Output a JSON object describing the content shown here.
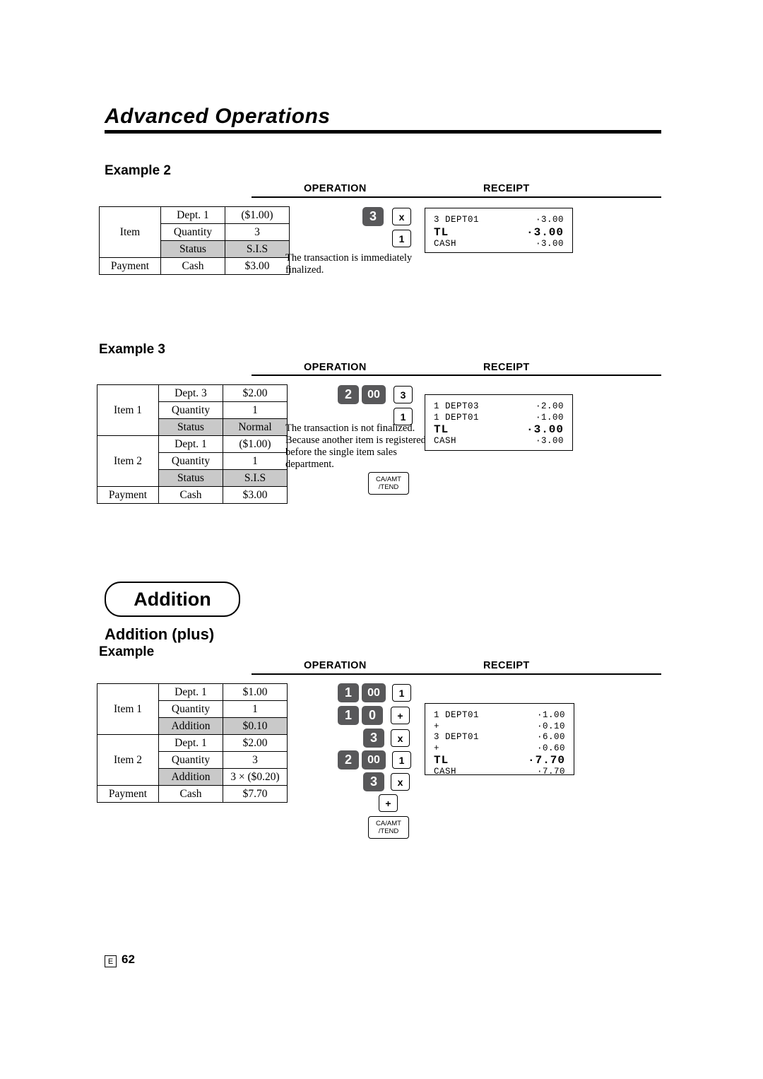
{
  "page": {
    "title": "Advanced Operations",
    "footer_mark": "E",
    "footer_page": "62"
  },
  "columns": {
    "operation": "OPERATION",
    "receipt": "RECEIPT"
  },
  "example2": {
    "heading": "Example 2",
    "table": [
      {
        "c1": "Item",
        "c2": "Dept. 1",
        "c3": "($1.00)",
        "shade": false
      },
      {
        "c1": "",
        "c2": "Quantity",
        "c3": "3",
        "shade": false
      },
      {
        "c1": "",
        "c2": "Status",
        "c3": "S.I.S",
        "shade": true
      },
      {
        "c1": "Payment",
        "c2": "Cash",
        "c3": "$3.00",
        "shade": false
      }
    ],
    "keys": [
      {
        "label": "3",
        "type": "dark"
      },
      {
        "label": "x",
        "type": "light"
      },
      {
        "label": "1",
        "type": "light"
      }
    ],
    "note": "The transaction is immediately finalized.",
    "receipt": [
      {
        "left": "3 DEPT01",
        "right": "·3.00",
        "big": false
      },
      {
        "left": "TL",
        "right": "·3.00",
        "big": true
      },
      {
        "left": "CASH",
        "right": "·3.00",
        "big": false
      }
    ]
  },
  "example3": {
    "heading": "Example 3",
    "table": [
      {
        "c1": "Item 1",
        "c2": "Dept. 3",
        "c3": "$2.00",
        "shade": false
      },
      {
        "c1": "",
        "c2": "Quantity",
        "c3": "1",
        "shade": false
      },
      {
        "c1": "",
        "c2": "Status",
        "c3": "Normal",
        "shade": true
      },
      {
        "c1": "Item 2",
        "c2": "Dept. 1",
        "c3": "($1.00)",
        "shade": false
      },
      {
        "c1": "",
        "c2": "Quantity",
        "c3": "1",
        "shade": false
      },
      {
        "c1": "",
        "c2": "Status",
        "c3": "S.I.S",
        "shade": true
      },
      {
        "c1": "Payment",
        "c2": "Cash",
        "c3": "$3.00",
        "shade": false
      }
    ],
    "keys_row1": [
      {
        "label": "2",
        "type": "dark"
      },
      {
        "label": "00",
        "type": "dark"
      },
      {
        "label": "3",
        "type": "dark"
      }
    ],
    "keys_row2": [
      {
        "label": "1",
        "type": "light"
      }
    ],
    "key_tender": {
      "line1": "CA/AMT",
      "line2": "/TEND"
    },
    "note": "The transaction is not finalized. Because another item is registered before the single item sales department.",
    "receipt": [
      {
        "left": "1 DEPT03",
        "right": "·2.00",
        "big": false
      },
      {
        "left": "1 DEPT01",
        "right": "·1.00",
        "big": false
      },
      {
        "left": "TL",
        "right": "·3.00",
        "big": true
      },
      {
        "left": "CASH",
        "right": "·3.00",
        "big": false
      }
    ]
  },
  "addition": {
    "banner": "Addition",
    "subheading": "Addition (plus)",
    "example_heading": "Example",
    "table": [
      {
        "c1": "Item 1",
        "c2": "Dept. 1",
        "c3": "$1.00",
        "shade": false
      },
      {
        "c1": "",
        "c2": "Quantity",
        "c3": "1",
        "shade": false
      },
      {
        "c1": "",
        "c2": "Addition",
        "c3": "$0.10",
        "shade": true
      },
      {
        "c1": "Item 2",
        "c2": "Dept. 1",
        "c3": "$2.00",
        "shade": false
      },
      {
        "c1": "",
        "c2": "Quantity",
        "c3": "3",
        "shade": false
      },
      {
        "c1": "",
        "c2": "Addition",
        "c3": "3 × ($0.20)",
        "shade": false
      },
      {
        "c1": "Payment",
        "c2": "Cash",
        "c3": "$7.70",
        "shade": false
      }
    ],
    "keys_row1": [
      {
        "label": "1",
        "type": "dark"
      },
      {
        "label": "00",
        "type": "dark"
      },
      {
        "label": "1",
        "type": "light"
      }
    ],
    "keys_row2": [
      {
        "label": "1",
        "type": "dark"
      },
      {
        "label": "0",
        "type": "dark"
      },
      {
        "label": "+",
        "type": "light"
      }
    ],
    "keys_row3": [
      {
        "label": "3",
        "type": "dark"
      },
      {
        "label": "x",
        "type": "light"
      }
    ],
    "keys_row4": [
      {
        "label": "2",
        "type": "dark"
      },
      {
        "label": "00",
        "type": "dark"
      },
      {
        "label": "1",
        "type": "light"
      }
    ],
    "keys_row5": [
      {
        "label": "3",
        "type": "dark"
      },
      {
        "label": "x",
        "type": "light"
      }
    ],
    "keys_row6": [
      {
        "label": "+",
        "type": "light"
      }
    ],
    "key_tender": {
      "line1": "CA/AMT",
      "line2": "/TEND"
    },
    "receipt": [
      {
        "left": "1 DEPT01",
        "right": "·1.00",
        "big": false
      },
      {
        "left": "+",
        "right": "·0.10",
        "big": false
      },
      {
        "left": "3 DEPT01",
        "right": "·6.00",
        "big": false
      },
      {
        "left": "+",
        "right": "·0.60",
        "big": false
      },
      {
        "left": "TL",
        "right": "·7.70",
        "big": true
      },
      {
        "left": "CASH",
        "right": "·7.70",
        "big": false
      }
    ]
  }
}
